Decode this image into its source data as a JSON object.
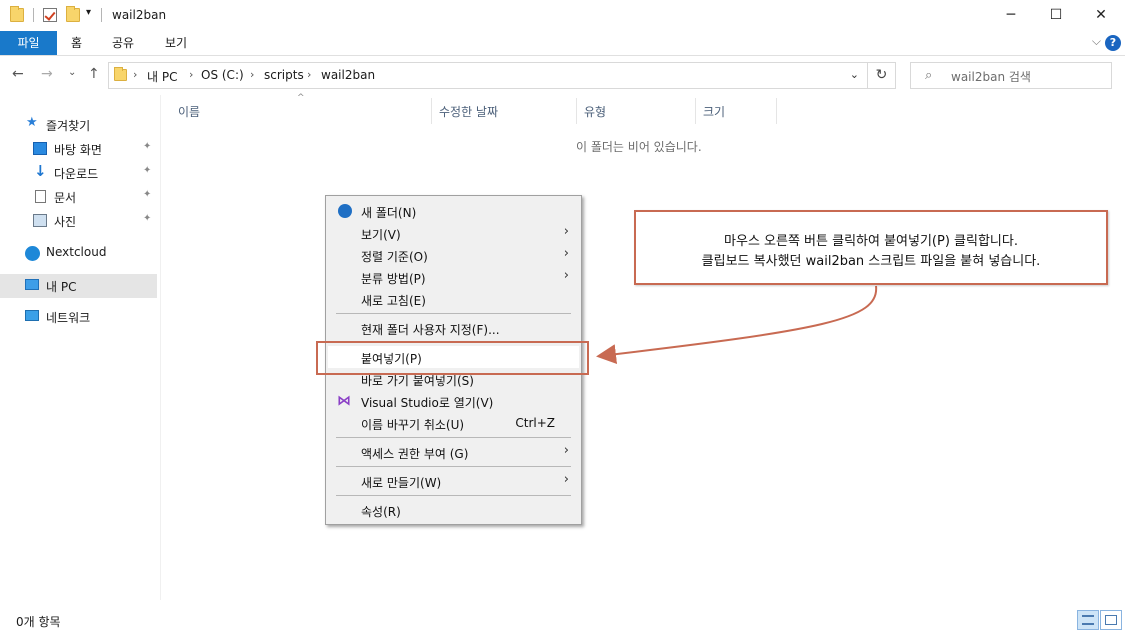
{
  "window": {
    "title": "wail2ban",
    "minimize": "─",
    "maximize": "☐",
    "close": "✕"
  },
  "ribbon": {
    "tabs": [
      "파일",
      "홈",
      "공유",
      "보기"
    ],
    "help": "?",
    "collapse": "⌵"
  },
  "nav": {
    "back": "←",
    "forward": "→",
    "recent": "⌄",
    "up": "↑"
  },
  "address": {
    "crumbs": [
      "내 PC",
      "OS (C:)",
      "scripts",
      "wail2ban"
    ],
    "sep": "›",
    "dropdown": "⌄",
    "refresh": "↻"
  },
  "search": {
    "placeholder": "wail2ban 검색",
    "icon": "⌕"
  },
  "sidebar": {
    "quick_access": "즐겨찾기",
    "items": [
      {
        "label": "바탕 화면",
        "pin": "📌"
      },
      {
        "label": "다운로드",
        "pin": "📌"
      },
      {
        "label": "문서",
        "pin": "📌"
      },
      {
        "label": "사진",
        "pin": "📌"
      }
    ],
    "nextcloud": "Nextcloud",
    "this_pc": "내 PC",
    "network": "네트워크"
  },
  "columns": {
    "name": "이름",
    "modified": "수정한 날짜",
    "type": "유형",
    "size": "크기",
    "sort_indicator": "^"
  },
  "empty_message": "이 폴더는 비어 있습니다.",
  "context_menu": {
    "items": [
      {
        "label": "새 폴더(N)"
      },
      {
        "label": "보기(V)",
        "submenu": "›"
      },
      {
        "label": "정렬 기준(O)",
        "submenu": "›"
      },
      {
        "label": "분류 방법(P)",
        "submenu": "›"
      },
      {
        "label": "새로 고침(E)"
      },
      {
        "label": "현재 폴더 사용자 지정(F)..."
      },
      {
        "label": "붙여넣기(P)"
      },
      {
        "label": "바로 가기 붙여넣기(S)"
      },
      {
        "label": "Visual Studio로 열기(V)"
      },
      {
        "label": "이름 바꾸기 취소(U)",
        "shortcut": "Ctrl+Z"
      },
      {
        "label": "액세스 권한 부여 (G)",
        "submenu": "›"
      },
      {
        "label": "새로 만들기(W)",
        "submenu": "›"
      },
      {
        "label": "속성(R)"
      }
    ]
  },
  "callout": {
    "line1": "마우스 오른쪽 버튼 클릭하여 붙여넣기(P) 클릭합니다.",
    "line2": "클립보드 복사했던 wail2ban 스크립트 파일을 붙혀 넣습니다.",
    "border_color": "#c86a52"
  },
  "status": {
    "item_count": "0개 항목"
  }
}
